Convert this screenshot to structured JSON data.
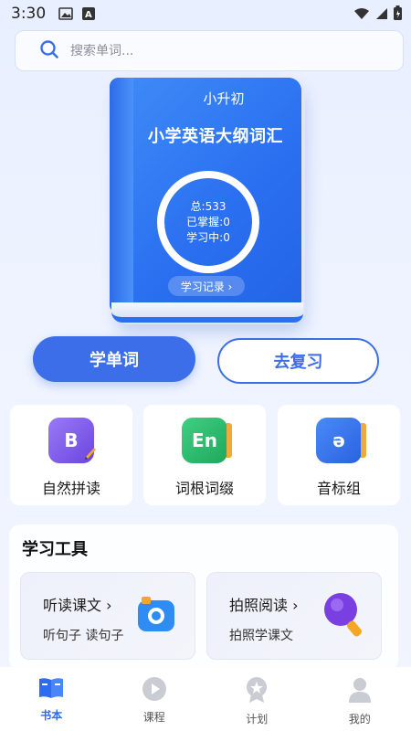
{
  "status_bar": {
    "time": "3:30"
  },
  "search": {
    "placeholder": "搜索单词..."
  },
  "book": {
    "grade": "小升初",
    "title": "小学英语大纲词汇",
    "stats": {
      "total_label": "总:",
      "total": "533",
      "mastered_label": "已掌握:",
      "mastered": "0",
      "learning_label": "学习中:",
      "learning": "0"
    },
    "record_label": "学习记录 ›"
  },
  "actions": {
    "learn": "学单词",
    "review": "去复习"
  },
  "features": [
    {
      "label": "自然拼读",
      "icon_text": "B",
      "icon": "phonics-icon",
      "color": "#7a55e8"
    },
    {
      "label": "词根词缀",
      "icon_text": "En",
      "icon": "word-root-icon",
      "color": "#27b36b"
    },
    {
      "label": "音标组",
      "icon_text": "ə",
      "icon": "phonetic-icon",
      "color": "#2f6ce6"
    }
  ],
  "tools": {
    "title": "学习工具",
    "cards": [
      {
        "title": "听读课文 ›",
        "subtitle": "听句子 读句子",
        "icon": "camera-icon"
      },
      {
        "title": "拍照阅读 ›",
        "subtitle": "拍照学课文",
        "icon": "magnifier-icon"
      }
    ]
  },
  "tabs": [
    {
      "label": "书本",
      "icon": "book-icon",
      "active": true
    },
    {
      "label": "课程",
      "icon": "play-icon",
      "active": false
    },
    {
      "label": "计划",
      "icon": "medal-icon",
      "active": false
    },
    {
      "label": "我的",
      "icon": "profile-icon",
      "active": false
    }
  ]
}
